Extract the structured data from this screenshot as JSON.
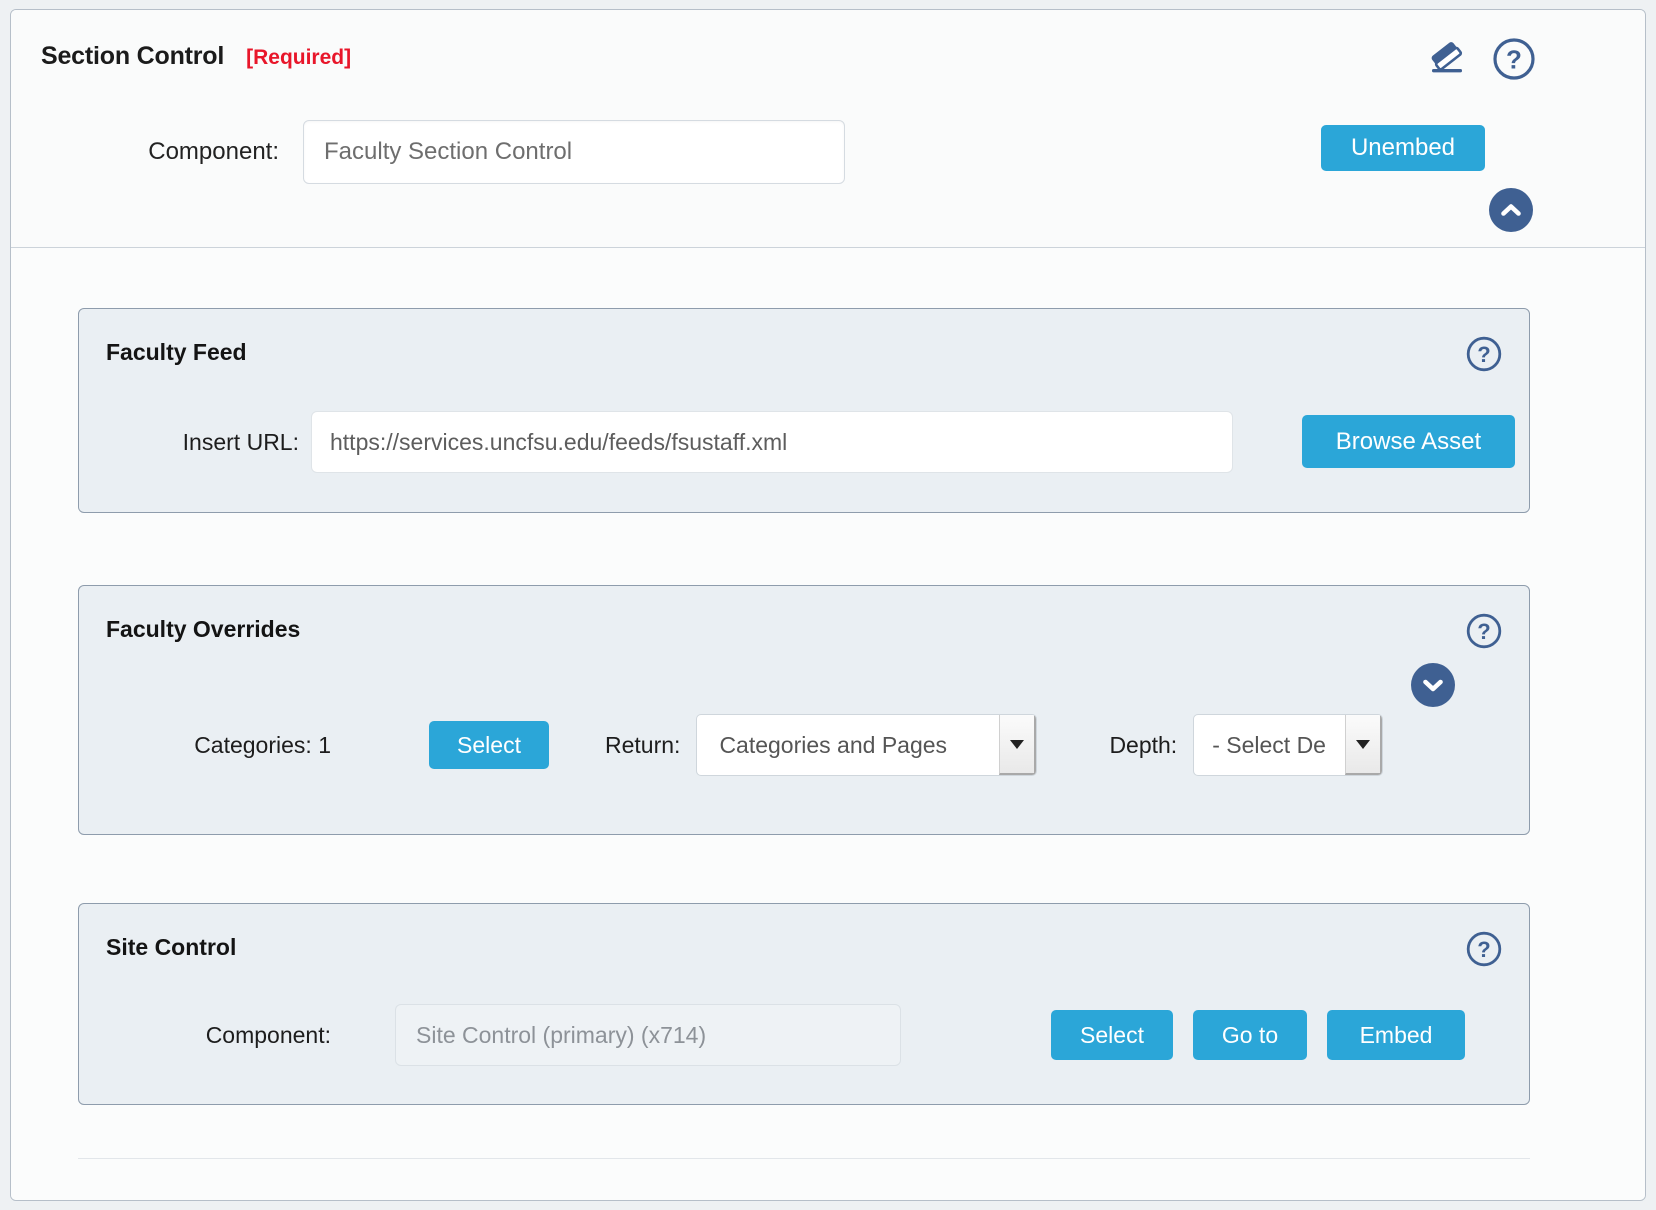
{
  "header": {
    "title": "Section Control",
    "required_flag": "[Required]",
    "component_label": "Component:",
    "component_value": "Faculty Section Control",
    "unembed_label": "Unembed",
    "eraser_icon": "eraser-icon",
    "help_icon": "help-icon",
    "collapse_icon": "chevron-up-icon"
  },
  "faculty_feed": {
    "title": "Faculty Feed",
    "url_label": "Insert URL:",
    "url_value": "https://services.uncfsu.edu/feeds/fsustaff.xml",
    "browse_label": "Browse Asset",
    "help_icon": "help-icon"
  },
  "faculty_overrides": {
    "title": "Faculty Overrides",
    "categories_label": "Categories: 1",
    "select_label": "Select",
    "return_label": "Return:",
    "return_value": "Categories and Pages",
    "depth_label": "Depth:",
    "depth_value": "- Select De",
    "help_icon": "help-icon",
    "expand_icon": "chevron-down-icon"
  },
  "site_control": {
    "title": "Site Control",
    "component_label": "Component:",
    "component_value": "Site Control (primary) (x714)",
    "select_label": "Select",
    "goto_label": "Go to",
    "embed_label": "Embed",
    "help_icon": "help-icon"
  },
  "colors": {
    "accent_blue": "#2ba6d8",
    "required_red": "#e8162a",
    "icon_navy": "#3f6092",
    "panel_bg": "#eaeff3"
  }
}
